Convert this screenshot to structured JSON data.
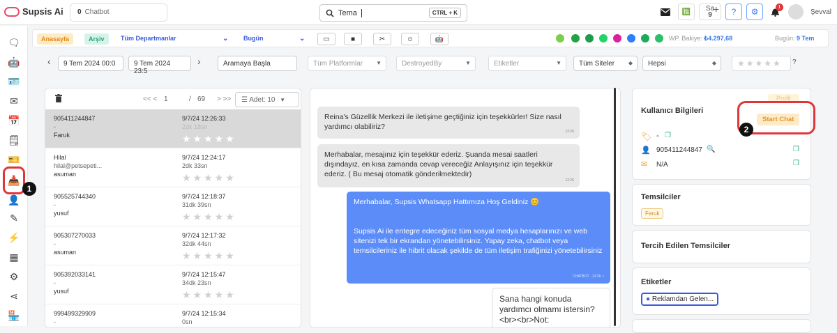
{
  "app": {
    "brand": "Supsis Ai",
    "chatbot_count": "0",
    "chatbot_label": "Chatbot"
  },
  "search": {
    "value": "Tema",
    "shortcut": "CTRL + K"
  },
  "topbar": {
    "sa_label": "Sa",
    "sa_count": "9",
    "notif_count": "1",
    "user_name": "Şevval"
  },
  "filterbar": {
    "home": "Anasayfa",
    "archive": "Arşiv",
    "department": "Tüm Departmanlar",
    "period": "Bugün",
    "balance_label": "WP. Bakiye:",
    "balance_value": "₺4.297,68",
    "today_label": "Bugün:",
    "today_value": "9 Tem"
  },
  "datefilters": {
    "start": "9 Tem 2024 00:0",
    "end": "9 Tem 2024 23:5",
    "search_placeholder": "Aramaya Başla",
    "platforms": "Tüm Platformlar",
    "destroyed": "DestroyedBy",
    "tags": "Etiketler",
    "sites": "Tüm Siteler",
    "all": "Hepsi",
    "rating_q": "?"
  },
  "list": {
    "nav_prev": "<< <",
    "page_current": "1",
    "page_sep": "/",
    "page_total": "69",
    "nav_next": "> >>",
    "count_label": "Adet: 10"
  },
  "rows": [
    {
      "phone": "905411244847",
      "sub": "-",
      "agent": "Faruk",
      "date": "9/7/24 12:26:33",
      "ago": "2dk 18sn"
    },
    {
      "phone": "Hilal",
      "sub": "hilal@petsepeti...",
      "agent": "asuman",
      "date": "9/7/24 12:24:17",
      "ago": "2dk 33sn"
    },
    {
      "phone": "905525744340",
      "sub": "-",
      "agent": "yusuf",
      "date": "9/7/24 12:18:37",
      "ago": "31dk 39sn"
    },
    {
      "phone": "905307270033",
      "sub": "-",
      "agent": "asuman",
      "date": "9/7/24 12:17:32",
      "ago": "32dk 44sn"
    },
    {
      "phone": "905392033141",
      "sub": "-",
      "agent": "yusuf",
      "date": "9/7/24 12:15:47",
      "ago": "34dk 23sn"
    },
    {
      "phone": "999499329909",
      "sub": "-",
      "agent": "",
      "date": "9/7/24 12:15:34",
      "ago": "0sn"
    }
  ],
  "messages": [
    {
      "text": "Reina's Güzellik Merkezi ile iletişime geçtiğiniz için teşekkürler! Size nasıl yardımcı olabiliriz?",
      "time": "12:26"
    },
    {
      "text": "Merhabalar, mesajınız için teşekkür ederiz. Şuanda mesai saatleri dışındayız, en kısa zamanda cevap vereceğiz Anlayışınız için teşekkür ederiz. ( Bu mesaj otomatik gönderilmektedir)",
      "time": "12:26"
    },
    {
      "text": "Merhabalar, Supsis Whatsapp Hattımıza Hoş Geldiniz 😊",
      "text2": "Supsis Ai ile entegre edeceğiniz tüm sosyal medya hesaplarınızı ve web sitenizi tek bir ekrandan yönetebilirsiniz. Yapay zeka, chatbot veya temsilcileriniz ile hibrit olacak şekilde de tüm iletişim trafiğinizi yönetebilirsiniz",
      "time": "CHATBOT - 12:26 ✓"
    },
    {
      "text": "Sana hangi konuda yardımcı olmamı istersin?<br><br>Not:"
    }
  ],
  "user_info": {
    "title": "Kullanıcı Bilgileri",
    "faded_btn": "Profil",
    "start_chat": "Start Chat",
    "tag_dash": "-",
    "phone": "905411244847",
    "email": "N/A"
  },
  "reps": {
    "title": "Temsilciler",
    "chip": "Faruk"
  },
  "preferred": {
    "title": "Tercih Edilen Temsilciler"
  },
  "tags": {
    "title": "Etiketler",
    "chip": "Reklamdan Gelen..."
  },
  "annotations": {
    "one": "1",
    "two": "2"
  },
  "colors": {
    "accent": "#3a7bea",
    "highlight": "#e0363a",
    "outgoing": "#5b8cf8"
  }
}
